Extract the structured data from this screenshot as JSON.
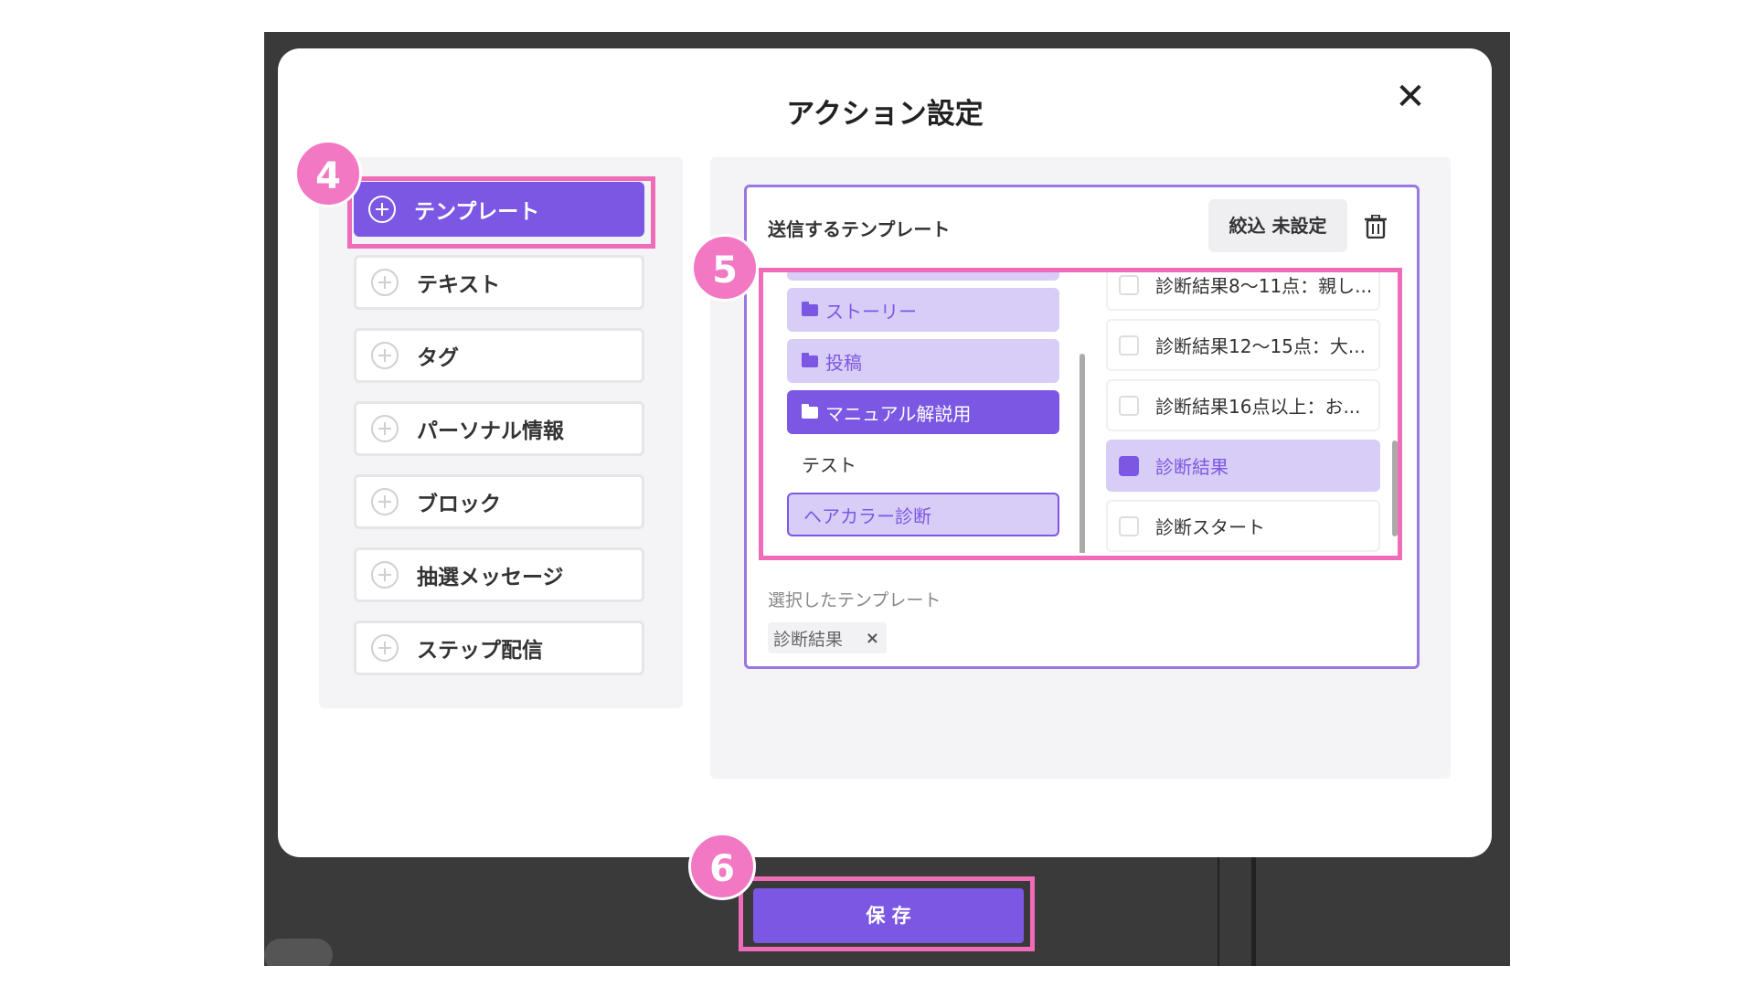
{
  "modal": {
    "title": "アクション設定",
    "close_label": "✕"
  },
  "actions": [
    {
      "label": "テンプレート",
      "active": true
    },
    {
      "label": "テキスト"
    },
    {
      "label": "タグ"
    },
    {
      "label": "パーソナル情報"
    },
    {
      "label": "ブロック"
    },
    {
      "label": "抽選メッセージ"
    },
    {
      "label": "ステップ配信"
    }
  ],
  "steps": [
    "4",
    "5",
    "6"
  ],
  "template_picker": {
    "title": "送信するテンプレート",
    "filter_label": "絞込 未設定",
    "folders": [
      {
        "label": "ストーリー",
        "state": "folder"
      },
      {
        "label": "投稿",
        "state": "folder"
      },
      {
        "label": "マニュアル解説用",
        "state": "open"
      },
      {
        "label": "テスト",
        "state": "plain"
      },
      {
        "label": "ヘアカラー診断",
        "state": "highlight"
      }
    ],
    "templates": [
      {
        "label": "診断結果8〜11点：親し...",
        "checked": false
      },
      {
        "label": "診断結果12〜15点：大...",
        "checked": false
      },
      {
        "label": "診断結果16点以上：お...",
        "checked": false
      },
      {
        "label": "診断結果",
        "checked": true
      },
      {
        "label": "診断スタート",
        "checked": false
      }
    ],
    "selected_label": "選択したテンプレート",
    "selected_chip": "診断結果",
    "chip_remove": "×"
  },
  "save_label": "保 存",
  "colors": {
    "accent": "#7b57e3",
    "highlight": "#f06bb8",
    "light_accent": "#d8cdf6"
  }
}
